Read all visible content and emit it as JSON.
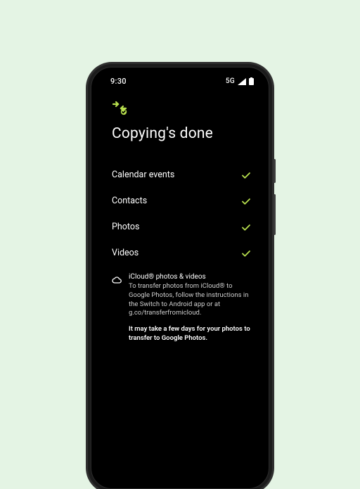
{
  "accent": "#b8e04e",
  "status": {
    "time": "9:30",
    "network": "5G"
  },
  "title": "Copying's done",
  "items": [
    {
      "label": "Calendar events",
      "done": true
    },
    {
      "label": "Contacts",
      "done": true
    },
    {
      "label": "Photos",
      "done": true
    },
    {
      "label": "Videos",
      "done": true
    }
  ],
  "icloud": {
    "heading": "iCloud® photos & videos",
    "body": "To transfer photos from iCloud® to Google Photos, follow the instructions in the Switch to Android app or at g.co/transferfromicloud."
  },
  "footnote": "It may take a few days for your photos to transfer to Google Photos."
}
